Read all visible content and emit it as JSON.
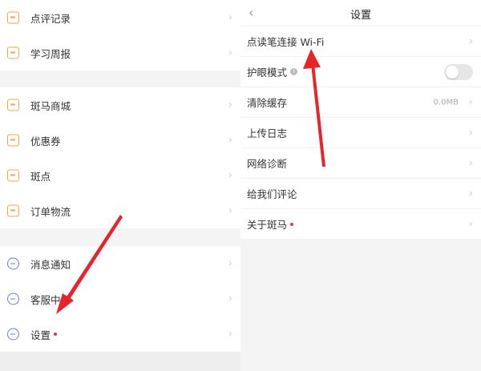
{
  "left_menu": {
    "group1": [
      {
        "label": "点评记录",
        "icon": "comment-record-icon"
      },
      {
        "label": "学习周报",
        "icon": "weekly-report-icon"
      }
    ],
    "group2": [
      {
        "label": "斑马商城",
        "icon": "shop-icon"
      },
      {
        "label": "优惠券",
        "icon": "coupon-icon"
      },
      {
        "label": "斑点",
        "icon": "points-icon"
      },
      {
        "label": "订单物流",
        "icon": "order-logistics-icon"
      }
    ],
    "group3": [
      {
        "label": "消息通知",
        "icon": "notification-icon"
      },
      {
        "label": "客服中心",
        "icon": "customer-service-icon"
      },
      {
        "label": "设置",
        "icon": "settings-icon",
        "red_dot": true
      }
    ]
  },
  "settings": {
    "title": "设置",
    "items": [
      {
        "label": "点读笔连接 Wi-Fi"
      },
      {
        "label": "护眼模式",
        "toggle": false
      },
      {
        "label": "清除缓存",
        "value": "0.0MB"
      },
      {
        "label": "上传日志"
      },
      {
        "label": "网络诊断"
      },
      {
        "label": "给我们评论"
      },
      {
        "label": "关于斑马",
        "red_dot": true
      }
    ]
  },
  "colors": {
    "accent_orange": "#f5a640",
    "accent_blue": "#6d7df0",
    "red_dot": "#e53935",
    "arrow_red": "#e8232a"
  }
}
